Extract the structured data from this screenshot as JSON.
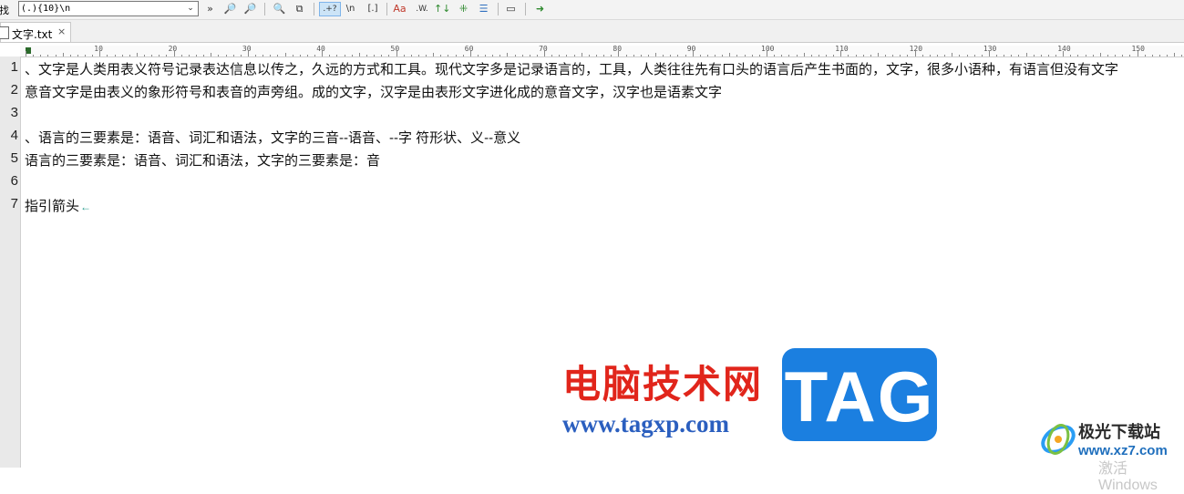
{
  "toolbar": {
    "find_label": "查找",
    "find_value": "(.){10}\\n",
    "buttons": [
      {
        "name": "expand",
        "glyph": "»"
      },
      {
        "name": "find-prev",
        "glyph": "🔎"
      },
      {
        "name": "find-next",
        "glyph": "🔎"
      },
      {
        "name": "find-in-files",
        "glyph": "🔍"
      },
      {
        "name": "copy",
        "glyph": "⧉"
      },
      {
        "name": "regex",
        "glyph": ".+?"
      },
      {
        "name": "newline",
        "glyph": "\\n"
      },
      {
        "name": "brackets",
        "glyph": "[.]"
      },
      {
        "name": "match-case",
        "glyph": "Aa"
      },
      {
        "name": "whole-word",
        "glyph": ".W."
      },
      {
        "name": "wrap",
        "glyph": "↑↓"
      },
      {
        "name": "mark",
        "glyph": "⁜"
      },
      {
        "name": "list",
        "glyph": "☰"
      },
      {
        "name": "panel",
        "glyph": "▭"
      },
      {
        "name": "go",
        "glyph": "➜"
      }
    ]
  },
  "tabs": [
    {
      "label": "文字.txt",
      "close": "×"
    }
  ],
  "ruler": {
    "labels": [
      "10",
      "20",
      "30",
      "40",
      "50",
      "60",
      "70",
      "80",
      "90",
      "100",
      "110",
      "120",
      "130",
      "140",
      "150"
    ]
  },
  "editor": {
    "lines": [
      {
        "num": "1",
        "text": "、文字是人类用表义符号记录表达信息以传之，久远的方式和工具。现代文字多是记录语言的，工具，人类往往先有口头的语言后产生书面的，文字，很多小语种，有语言但没有文字"
      },
      {
        "num": "2",
        "text": "意音文字是由表义的象形符号和表音的声旁组。成的文字，汉字是由表形文字进化成的意音文字，汉字也是语素文字"
      },
      {
        "num": "3",
        "text": ""
      },
      {
        "num": "4",
        "text": "、语言的三要素是：语音、词汇和语法，文字的三音--语音、--字 符形状、义--意义"
      },
      {
        "num": "5",
        "text": "语言的三要素是：语音、词汇和语法，文字的三要素是：音"
      },
      {
        "num": "6",
        "text": ""
      },
      {
        "num": "7",
        "text": "指引箭头",
        "cr": "←"
      }
    ]
  },
  "watermark": {
    "cn_name": "电脑技术网",
    "url": "www.tagxp.com",
    "tag": "TAG",
    "site2_name": "极光下载站",
    "site2_url": "www.xz7.com",
    "windows_activation": "激活 Windows"
  },
  "colors": {
    "watermark_red": "#e1251b",
    "watermark_blue": "#1b7fe0",
    "url_blue": "#2b5fbf"
  }
}
